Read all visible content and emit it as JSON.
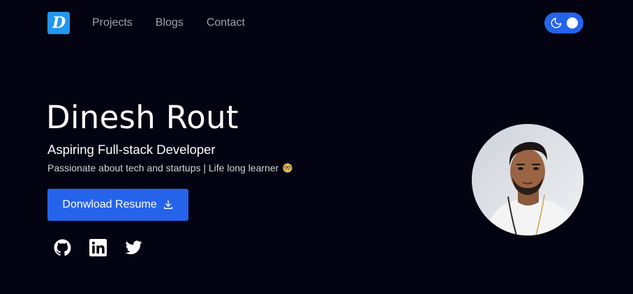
{
  "nav": {
    "logo_letter": "D",
    "links": [
      {
        "label": "Projects"
      },
      {
        "label": "Blogs"
      },
      {
        "label": "Contact"
      }
    ],
    "theme_toggle": {
      "icon": "moon-icon",
      "state": "dark"
    }
  },
  "hero": {
    "name": "Dinesh Rout",
    "role": "Aspiring Full-stack Developer",
    "tagline": "Passionate about tech and startups | Life long learner",
    "tagline_emoji": "nerd-face-emoji",
    "resume_button": {
      "label": "Donwload Resume",
      "icon": "download-icon"
    },
    "socials": [
      {
        "icon": "github-icon"
      },
      {
        "icon": "linkedin-icon"
      },
      {
        "icon": "twitter-icon"
      }
    ],
    "avatar": {
      "icon": "profile-photo"
    }
  },
  "colors": {
    "background": "#030312",
    "accent": "#2563eb",
    "logo_bg": "#2296f0",
    "nav_text": "#a1a1aa"
  }
}
